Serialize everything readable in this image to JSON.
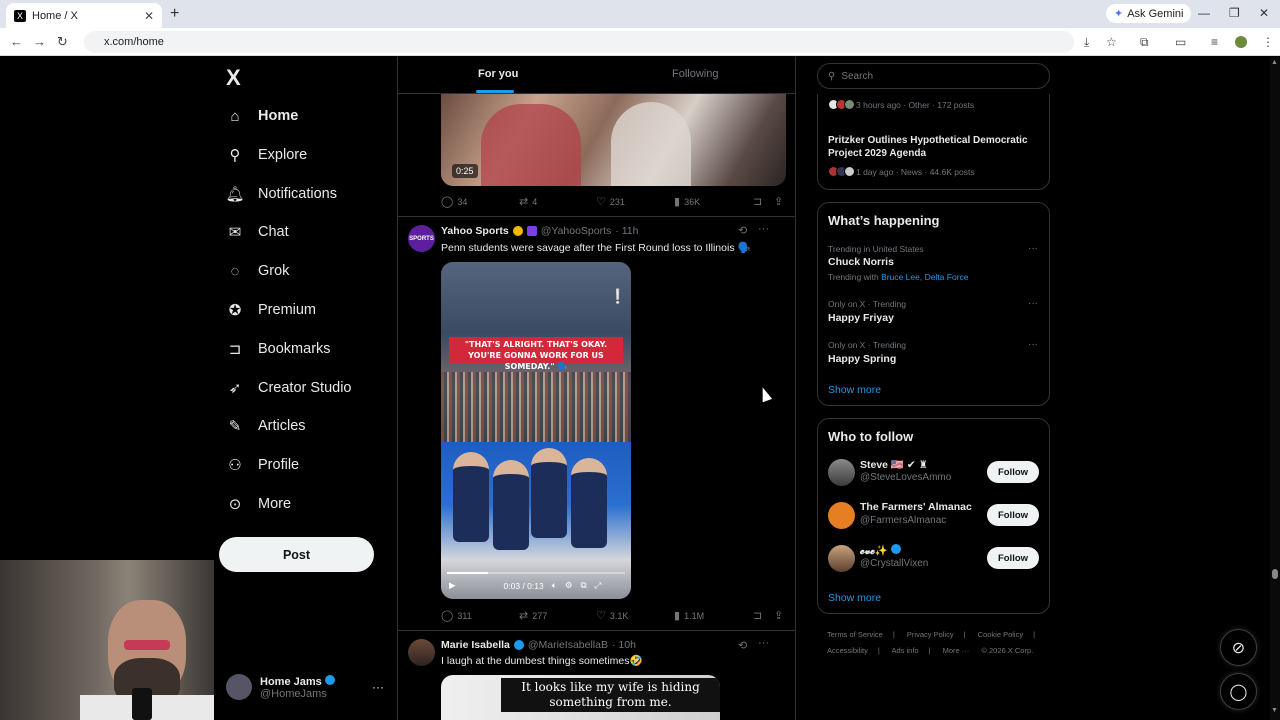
{
  "browser": {
    "tab_title": "Home / X",
    "tab_favicon": "X",
    "url": "x.com/home",
    "ask_gemini": "Ask Gemini"
  },
  "nav": {
    "logo": "X",
    "items": [
      {
        "label": "Home",
        "icon": "home-icon",
        "active": true
      },
      {
        "label": "Explore",
        "icon": "search-icon"
      },
      {
        "label": "Notifications",
        "icon": "bell-icon"
      },
      {
        "label": "Chat",
        "icon": "mail-icon"
      },
      {
        "label": "Grok",
        "icon": "grok-icon"
      },
      {
        "label": "Premium",
        "icon": "premium-icon"
      },
      {
        "label": "Bookmarks",
        "icon": "bookmark-icon"
      },
      {
        "label": "Creator Studio",
        "icon": "rocket-icon"
      },
      {
        "label": "Articles",
        "icon": "articles-icon"
      },
      {
        "label": "Profile",
        "icon": "person-icon"
      },
      {
        "label": "More",
        "icon": "more-circle-icon"
      }
    ],
    "post_label": "Post",
    "account": {
      "name": "Home Jams",
      "handle": "@HomeJams"
    }
  },
  "feed": {
    "tabs": [
      {
        "label": "For you",
        "active": true
      },
      {
        "label": "Following"
      }
    ],
    "tweet0": {
      "duration": "0:25",
      "replies": "34",
      "reposts": "4",
      "likes": "231",
      "views": "36K"
    },
    "tweet1": {
      "name": "Yahoo Sports",
      "handle": "@YahooSports",
      "time": "· 11h",
      "text": "Penn students were savage after the First Round loss to Illinois 🗣️",
      "video_banner": "\"THAT'S ALRIGHT. THAT'S OKAY. YOU'RE GONNA WORK FOR US SOMEDAY.\" 🗣️",
      "video_time": "0:03 / 0:13",
      "progress": 0.23,
      "replies": "311",
      "reposts": "277",
      "likes": "3.1K",
      "views": "1.1M"
    },
    "tweet2": {
      "name": "Marie Isabella",
      "handle": "@MarieIsabellaB",
      "time": "· 10h",
      "text": "I laugh at the dumbest things sometimes🤣",
      "video_caption": "It looks like my wife is hiding something from me."
    }
  },
  "sidebar": {
    "search_placeholder": "Search",
    "news": [
      {
        "meta": "3 hours ago · Other · 172 posts"
      },
      {
        "headline": "Pritzker Outlines Hypothetical Democratic Project 2029 Agenda",
        "meta": "1 day ago · News · 44.6K posts"
      }
    ],
    "happening": {
      "title": "What’s happening",
      "trends": [
        {
          "context": "Trending in United States",
          "name": "Chuck Norris",
          "with_label": "Trending with",
          "with": "Bruce Lee, Delta Force"
        },
        {
          "context": "Only on X · Trending",
          "name": "Happy Friyay"
        },
        {
          "context": "Only on X · Trending",
          "name": "Happy Spring"
        }
      ],
      "show_more": "Show more"
    },
    "who_to_follow": {
      "title": "Who to follow",
      "accounts": [
        {
          "name": "Steve 🇺🇸 ✔ ♜",
          "handle": "@SteveLovesAmmo",
          "button": "Follow"
        },
        {
          "name": "The Farmers' Almanac",
          "handle": "@FarmersAlmanac",
          "button": "Follow"
        },
        {
          "name": "𝓮𝓿𝓮✨",
          "handle": "@CrystallVixen",
          "button": "Follow"
        }
      ],
      "show_more": "Show more"
    },
    "footer": [
      "Terms of Service",
      "|",
      "Privacy Policy",
      "|",
      "Cookie Policy",
      "|",
      "Accessibility",
      "|",
      "Ads info",
      "|",
      "More ···",
      "© 2026 X Corp."
    ]
  }
}
